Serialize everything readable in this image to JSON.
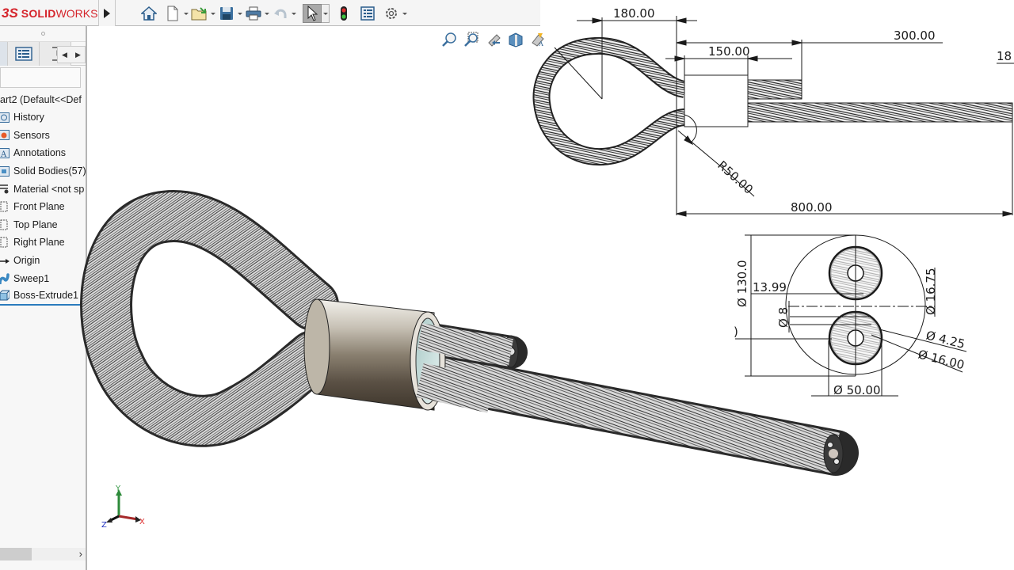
{
  "app": {
    "brand_prefix": "3S",
    "brand_bold": "SOLID",
    "brand_light": "WORKS",
    "brand_color": "#d5242b"
  },
  "toolbar": {
    "expand_icon": "play-triangle",
    "tools": [
      {
        "name": "home",
        "icon": "home-icon",
        "has_dropdown": false
      },
      {
        "name": "new",
        "icon": "new-document-icon",
        "has_dropdown": true
      },
      {
        "name": "open",
        "icon": "open-folder-icon",
        "has_dropdown": true
      },
      {
        "name": "save",
        "icon": "save-icon",
        "has_dropdown": true
      },
      {
        "name": "print",
        "icon": "print-icon",
        "has_dropdown": true
      },
      {
        "name": "undo",
        "icon": "undo-icon",
        "has_dropdown": true,
        "disabled": true
      },
      {
        "name": "select",
        "icon": "cursor-icon",
        "has_dropdown": true,
        "selected": true
      },
      {
        "name": "rebuild",
        "icon": "traffic-light-icon",
        "has_dropdown": false
      },
      {
        "name": "file-properties",
        "icon": "properties-icon",
        "has_dropdown": false
      },
      {
        "name": "options",
        "icon": "gear-icon",
        "has_dropdown": true
      }
    ]
  },
  "sidebar": {
    "tabs": [
      "feature-manager",
      "property-manager",
      "configuration-manager"
    ],
    "root_label": "art2  (Default<<Def",
    "items": [
      {
        "label": "History",
        "icon": "history-icon"
      },
      {
        "label": "Sensors",
        "icon": "sensors-icon"
      },
      {
        "label": "Annotations",
        "icon": "annotations-icon"
      },
      {
        "label": "Solid Bodies(57)",
        "icon": "solid-bodies-icon"
      },
      {
        "label": "Material <not sp",
        "icon": "material-icon"
      },
      {
        "label": "Front Plane",
        "icon": "plane-icon"
      },
      {
        "label": "Top Plane",
        "icon": "plane-icon"
      },
      {
        "label": "Right Plane",
        "icon": "plane-icon"
      },
      {
        "label": "Origin",
        "icon": "origin-icon"
      },
      {
        "label": "Sweep1",
        "icon": "sweep-icon"
      },
      {
        "label": "Boss-Extrude1",
        "icon": "extrude-icon",
        "selected": true
      }
    ]
  },
  "viewport": {
    "heads_up_tools": [
      "zoom-to-fit-icon",
      "zoom-to-area-icon",
      "previous-view-icon",
      "section-view-icon",
      "view-orientation-icon"
    ],
    "triad": {
      "x": "X",
      "y": "Y",
      "z": "Z"
    }
  },
  "drawing": {
    "side_view_dims": {
      "loop_length": "180.00",
      "tail_length": "300.00",
      "sleeve_length": "150.00",
      "bend_radius": "R50.00",
      "overall_length": "800.00",
      "cut_off_label": "18"
    },
    "section_view_dims": {
      "outer_diameter": "Ø 130.0",
      "offset": "13.99",
      "small_dia": "Ø 8",
      "right_dim": "Ø 16.75",
      "core_dia": "Ø 4.25",
      "strand_dia": "Ø 16.00",
      "rope_dia": "Ø 50.00",
      "cut_left": ")"
    }
  }
}
